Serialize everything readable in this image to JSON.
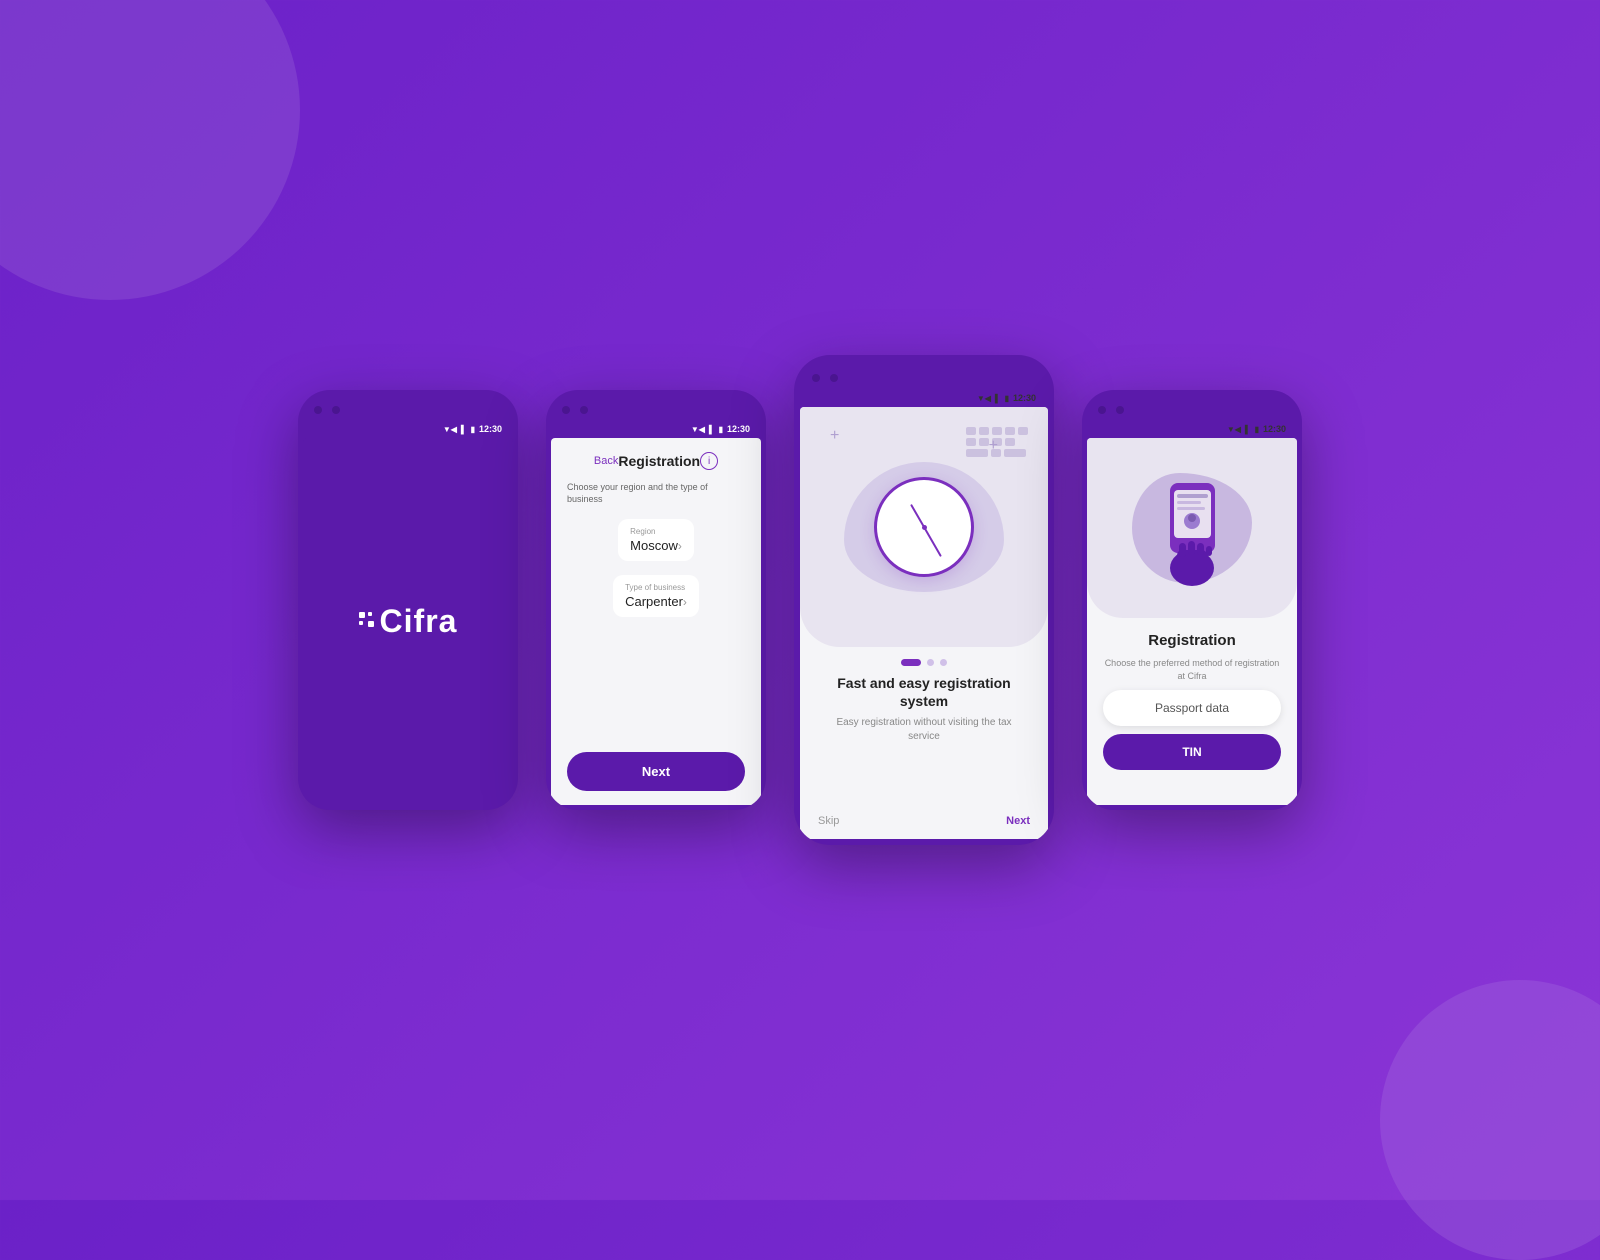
{
  "background": {
    "color": "#7B2FBE"
  },
  "phone1": {
    "status_time": "12:30",
    "logo_text": "Cifra"
  },
  "phone2": {
    "status_time": "12:30",
    "back_label": "Back",
    "title": "Registration",
    "subtitle": "Choose your region and the type of business",
    "region_label": "Region",
    "region_value": "Moscow",
    "business_label": "Type of business",
    "business_value": "Carpenter",
    "next_button": "Next"
  },
  "phone3": {
    "status_time": "12:30",
    "onboarding_title": "Fast and easy registration system",
    "onboarding_desc": "Easy registration without visiting the tax service",
    "skip_label": "Skip",
    "next_label": "Next",
    "dots": [
      {
        "active": true
      },
      {
        "active": false
      },
      {
        "active": false
      }
    ]
  },
  "phone4": {
    "status_time": "12:30",
    "title": "Registration",
    "desc": "Choose the preferred method of registration at Cifra",
    "passport_button": "Passport data",
    "tin_button": "TIN"
  }
}
